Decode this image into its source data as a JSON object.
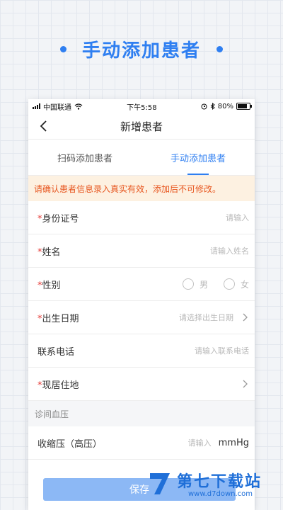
{
  "promo": {
    "title": "手动添加患者"
  },
  "status_bar": {
    "carrier": "中国联通",
    "time": "下午5:58",
    "battery": "80%",
    "battery_level": 0.8
  },
  "nav": {
    "title": "新增患者"
  },
  "tabs": [
    {
      "label": "扫码添加患者",
      "active": false
    },
    {
      "label": "手动添加患者",
      "active": true
    }
  ],
  "warning": "请确认患者信息录入真实有效，添加后不可修改。",
  "fields": {
    "id_number": {
      "label": "身份证号",
      "placeholder": "请输入"
    },
    "name": {
      "label": "姓名",
      "placeholder": "请输入姓名"
    },
    "gender": {
      "label": "性别",
      "options": [
        "男",
        "女"
      ]
    },
    "birthdate": {
      "label": "出生日期",
      "placeholder": "请选择出生日期"
    },
    "phone": {
      "label": "联系电话",
      "placeholder": "请输入联系电话"
    },
    "address": {
      "label": "现居住地"
    }
  },
  "section_bp": {
    "title": "诊间血压"
  },
  "systolic": {
    "label": "收缩压（高压）",
    "placeholder": "请输入",
    "unit": "mmHg"
  },
  "save_label": "保存",
  "watermark": {
    "title": "第七下载站",
    "url": "www.d7down.com"
  },
  "colors": {
    "accent": "#2f7ff1",
    "warning_text": "#e7561f",
    "warning_bg": "#fdf1e1",
    "required": "#e53935"
  },
  "icons": [
    "wifi-icon",
    "back-arrow-icon",
    "chevron-right-icon",
    "bluetooth-icon",
    "alarm-icon"
  ]
}
